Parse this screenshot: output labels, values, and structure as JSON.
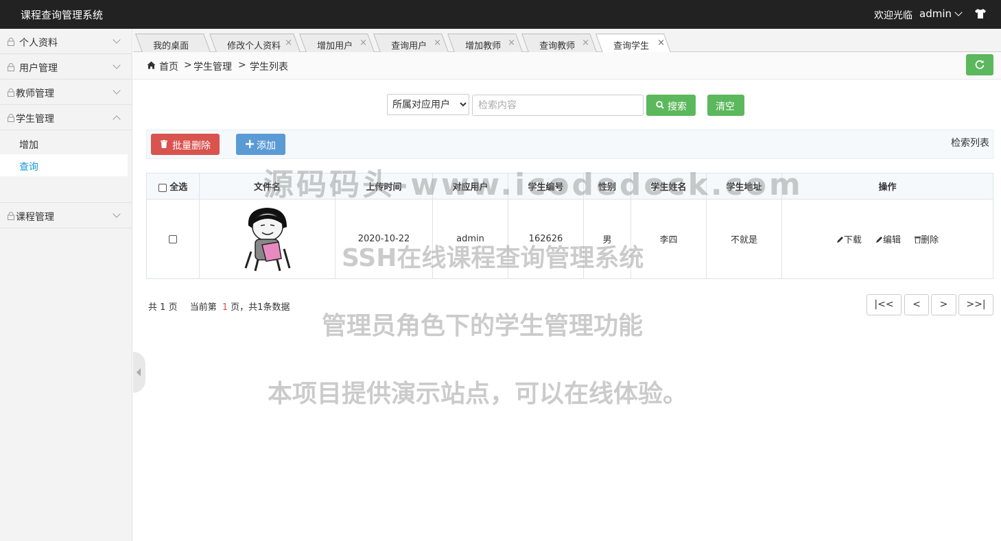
{
  "header": {
    "app_title": "课程查询管理系统",
    "welcome": "欢迎光临",
    "username": "admin"
  },
  "sidebar": {
    "items": [
      {
        "label": "个人资料",
        "expanded": false
      },
      {
        "label": "用户管理",
        "expanded": false
      },
      {
        "label": "教师管理",
        "expanded": false
      },
      {
        "label": "学生管理",
        "expanded": true,
        "children": [
          {
            "label": "增加"
          },
          {
            "label": "查询",
            "active": true
          }
        ]
      },
      {
        "label": "课程管理",
        "expanded": false
      }
    ]
  },
  "tabs": [
    {
      "label": "我的桌面",
      "closable": false
    },
    {
      "label": "修改个人资料",
      "closable": true
    },
    {
      "label": "增加用户",
      "closable": true
    },
    {
      "label": "查询用户",
      "closable": true
    },
    {
      "label": "增加教师",
      "closable": true
    },
    {
      "label": "查询教师",
      "closable": true
    },
    {
      "label": "查询学生",
      "closable": true,
      "active": true
    }
  ],
  "tab_close_glyph": "×",
  "breadcrumb": {
    "home": "首页",
    "sep1": ">",
    "section": "学生管理",
    "sep2": ">",
    "page": "学生列表"
  },
  "search": {
    "select_value": "所属对应用户",
    "placeholder": "检索内容",
    "search_label": "搜索",
    "clear_label": "清空"
  },
  "toolbar": {
    "batch_delete_label": "批量删除",
    "add_label": "添加",
    "search_list_label": "检索列表"
  },
  "table": {
    "select_all_label": "全选",
    "columns": [
      "文件名",
      "上传时间",
      "对应用户",
      "学生编号",
      "性别",
      "学生姓名",
      "学生地址",
      "操作"
    ],
    "rows": [
      {
        "upload_time": "2020-10-22",
        "user": "admin",
        "student_no": "162626",
        "gender": "男",
        "name": "李四",
        "address": "不就是"
      }
    ],
    "actions": {
      "download": "下载",
      "edit": "编辑",
      "delete": "删除"
    }
  },
  "pagination": {
    "total_pages_prefix": "共",
    "total_pages": "1",
    "total_pages_suffix": "页",
    "current_prefix": "当前第",
    "current_page": "1",
    "current_suffix": "页，共1条数据",
    "first": "|<<",
    "prev": "<",
    "next": ">",
    "last": ">>|"
  },
  "watermarks": {
    "line1": "源码码头-www.icodedock.com",
    "line2": "SSH在线课程查询管理系统",
    "line3": "管理员角色下的学生管理功能",
    "line4": "本项目提供演示站点，可以在线体验。"
  },
  "colors": {
    "header_bg": "#222222",
    "success": "#5cb85c",
    "danger": "#d9534f",
    "primary": "#5b9bd5",
    "active_link": "#1a9ad6"
  }
}
